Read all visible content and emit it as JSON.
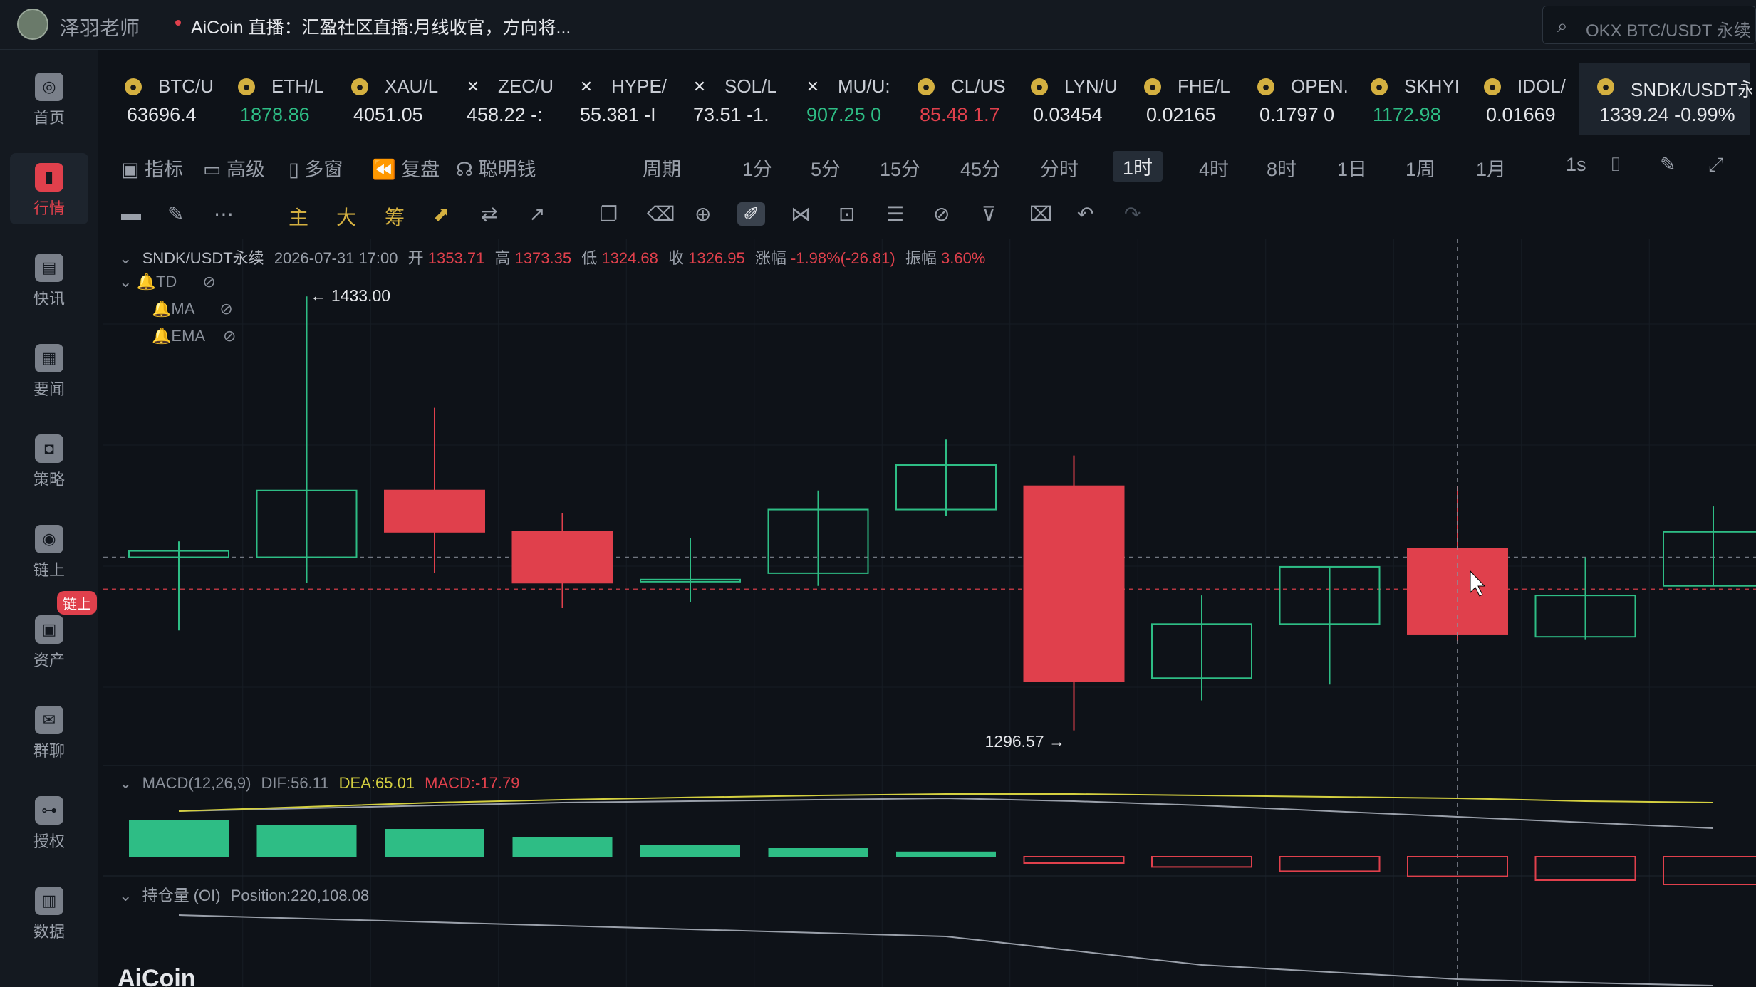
{
  "header": {
    "username": "泽羽老师",
    "live_text": "AiCoin 直播：汇盈社区直播:月线收官，方向将...",
    "search_placeholder": "OKX BTC/USDT 永续"
  },
  "sidebar": [
    {
      "label": "首页",
      "icon": "home-icon",
      "active": false
    },
    {
      "label": "行情",
      "icon": "market-chart-icon",
      "active": true
    },
    {
      "label": "快讯",
      "icon": "flash-news-icon",
      "active": false
    },
    {
      "label": "要闻",
      "icon": "news-icon",
      "active": false
    },
    {
      "label": "策略",
      "icon": "robot-icon",
      "active": false
    },
    {
      "label": "链上",
      "icon": "onchain-icon",
      "active": false
    },
    {
      "label": "资产",
      "icon": "wallet-icon",
      "active": false
    },
    {
      "label": "群聊",
      "icon": "chat-icon",
      "active": false
    },
    {
      "label": "授权",
      "icon": "authorize-icon",
      "active": false
    },
    {
      "label": "数据",
      "icon": "data-icon",
      "active": false
    }
  ],
  "sidebar_badge": "链上",
  "tickers": [
    {
      "name": "BTC/U",
      "price": "63696.4",
      "color": "#e4e6ea",
      "icon": "coin"
    },
    {
      "name": "ETH/L",
      "price": "1878.86",
      "color": "#2ebd85",
      "icon": "coin"
    },
    {
      "name": "XAU/L",
      "price": "4051.05",
      "color": "#e4e6ea",
      "icon": "coin"
    },
    {
      "name": "ZEC/U",
      "price": "458.22 -:",
      "color": "#e4e6ea",
      "icon": "x"
    },
    {
      "name": "HYPE/",
      "price": "55.381 -I",
      "color": "#e4e6ea",
      "icon": "x"
    },
    {
      "name": "SOL/L",
      "price": "73.51 -1.",
      "color": "#e4e6ea",
      "icon": "x"
    },
    {
      "name": "MU/U:",
      "price": "907.25 0",
      "color": "#2ebd85",
      "icon": "x"
    },
    {
      "name": "CL/US",
      "price": "85.48 1.7",
      "color": "#e0404c",
      "icon": "coin"
    },
    {
      "name": "LYN/U",
      "price": "0.03454",
      "color": "#e4e6ea",
      "icon": "coin"
    },
    {
      "name": "FHE/L",
      "price": "0.02165",
      "color": "#e4e6ea",
      "icon": "coin"
    },
    {
      "name": "OPEN.",
      "price": "0.1797 0",
      "color": "#e4e6ea",
      "icon": "coin"
    },
    {
      "name": "SKHYI",
      "price": "1172.98",
      "color": "#2ebd85",
      "icon": "coin"
    },
    {
      "name": "IDOL/",
      "price": "0.01669",
      "color": "#e4e6ea",
      "icon": "coin"
    },
    {
      "name": "SNDK/USDT永",
      "price": "1339.24 -0.99%",
      "color": "#e4e6ea",
      "icon": "coin",
      "active": true
    }
  ],
  "toolbar": {
    "items": [
      "指标",
      "高级",
      "多窗",
      "复盘",
      "聪明钱",
      "周期",
      "1分",
      "5分",
      "15分",
      "45分",
      "分时",
      "1时",
      "4时",
      "8时",
      "1日",
      "1周",
      "1月",
      "1s"
    ],
    "active": "1时"
  },
  "drawbar": {
    "labels": [
      "主",
      "大",
      "筹"
    ]
  },
  "chart_info": {
    "symbol": "SNDK/USDT永续",
    "datetime": "2026-07-31 17:00",
    "open_label": "开",
    "open": "1353.71",
    "high_label": "高",
    "high": "1373.35",
    "low_label": "低",
    "low": "1324.68",
    "close_label": "收",
    "close": "1326.95",
    "change_label": "涨幅",
    "change": "-1.98%(-26.81)",
    "amp_label": "振幅",
    "amp": "3.60%",
    "indicators": [
      "TD",
      "MA",
      "EMA"
    ],
    "max_label": "← 1433.00",
    "min_label": "1296.57 →"
  },
  "macd": {
    "label": "MACD(12,26,9)",
    "dif": "DIF:56.11",
    "dea": "DEA:65.01",
    "macd": "MACD:-17.79"
  },
  "oi": {
    "label": "持仓量 (OI)",
    "position": "Position:220,108.08"
  },
  "brand": "AiCoin",
  "colors": {
    "up": "#2ebd85",
    "down": "#e0404c",
    "bg": "#0e1218"
  },
  "chart_data": {
    "type": "candlestick",
    "symbol": "SNDK/USDT永续",
    "interval": "1时",
    "candles": [
      {
        "open": 1351,
        "close": 1353,
        "high": 1356,
        "low": 1328
      },
      {
        "open": 1351,
        "close": 1372,
        "high": 1433,
        "low": 1343
      },
      {
        "open": 1372,
        "close": 1359,
        "high": 1398,
        "low": 1346
      },
      {
        "open": 1359,
        "close": 1343,
        "high": 1365,
        "low": 1335
      },
      {
        "open": 1344,
        "close": 1344,
        "high": 1357,
        "low": 1337
      },
      {
        "open": 1346,
        "close": 1366,
        "high": 1372,
        "low": 1342
      },
      {
        "open": 1366,
        "close": 1380,
        "high": 1388,
        "low": 1364
      },
      {
        "open": 1373.35,
        "close": 1312,
        "high": 1383,
        "low": 1296.57
      },
      {
        "open": 1313,
        "close": 1330,
        "high": 1339,
        "low": 1306
      },
      {
        "open": 1330,
        "close": 1348,
        "high": 1348,
        "low": 1311
      },
      {
        "open": 1353.71,
        "close": 1326.95,
        "high": 1373.35,
        "low": 1324.68
      },
      {
        "open": 1326,
        "close": 1339,
        "high": 1351,
        "low": 1325
      },
      {
        "open": 1342,
        "close": 1359,
        "high": 1367,
        "low": 1342
      }
    ],
    "reference_lines": [
      1351,
      1341
    ],
    "macd_hist": [
      8.5,
      7.5,
      6.5,
      4.5,
      2.8,
      2.0,
      1.2,
      -1.5,
      -2.4,
      -3.4,
      -4.6,
      -5.5,
      -6.5
    ],
    "dif_line": [
      62,
      63,
      64,
      65,
      65.5,
      66,
      66.5,
      65.5,
      64,
      62,
      60,
      58,
      56
    ],
    "dea_line": [
      62,
      63.5,
      65,
      66,
      66.8,
      67.5,
      68,
      68,
      67.5,
      67,
      66.5,
      65.5,
      65
    ],
    "oi_line": [
      230,
      229.5,
      229,
      228.5,
      228,
      227.5,
      227,
      225,
      223,
      222,
      221,
      220.5,
      220.1
    ]
  }
}
